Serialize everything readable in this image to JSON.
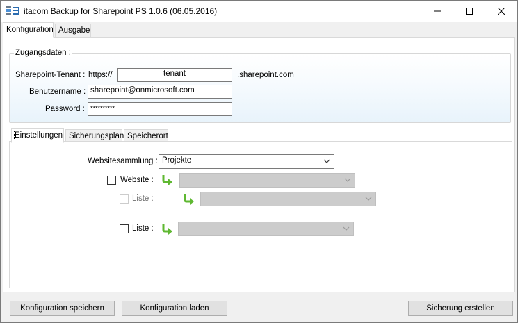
{
  "window": {
    "title": "itacom Backup for Sharepoint PS 1.0.6 (06.05.2016)"
  },
  "main_tabs": [
    {
      "label": "Konfiguration"
    },
    {
      "label": "Ausgabe"
    }
  ],
  "credentials": {
    "legend": "Zugangsdaten :",
    "tenant_label": "Sharepoint-Tenant :",
    "tenant_prefix": "https://",
    "tenant_value": "tenant",
    "tenant_suffix": ".sharepoint.com",
    "username_label": "Benutzername :",
    "username_value": "sharepoint@onmicrosoft.com",
    "password_label": "Password :",
    "password_value": "**********"
  },
  "inner_tabs": [
    {
      "label": "Einstellungen"
    },
    {
      "label": "Sicherungsplan"
    },
    {
      "label": "Speicherort"
    }
  ],
  "settings": {
    "collection_label": "Websitesammlung :",
    "collection_value": "Projekte",
    "website_label": "Website :",
    "website_checked": false,
    "website_list_label": "Liste :",
    "list_label": "Liste :",
    "list_checked": false
  },
  "buttons": {
    "save_config": "Konfiguration speichern",
    "load_config": "Konfiguration laden",
    "create_backup": "Sicherung erstellen"
  },
  "icons": {
    "app": "app-icon",
    "minimize": "minimize-icon",
    "maximize": "maximize-icon",
    "close": "close-icon",
    "combo_arrow": "chevron-down-icon",
    "sub_arrow": "green-return-arrow-icon"
  },
  "colors": {
    "sub_arrow": "#5fb832",
    "group_gradient_bottom": "#e8f3fb"
  }
}
